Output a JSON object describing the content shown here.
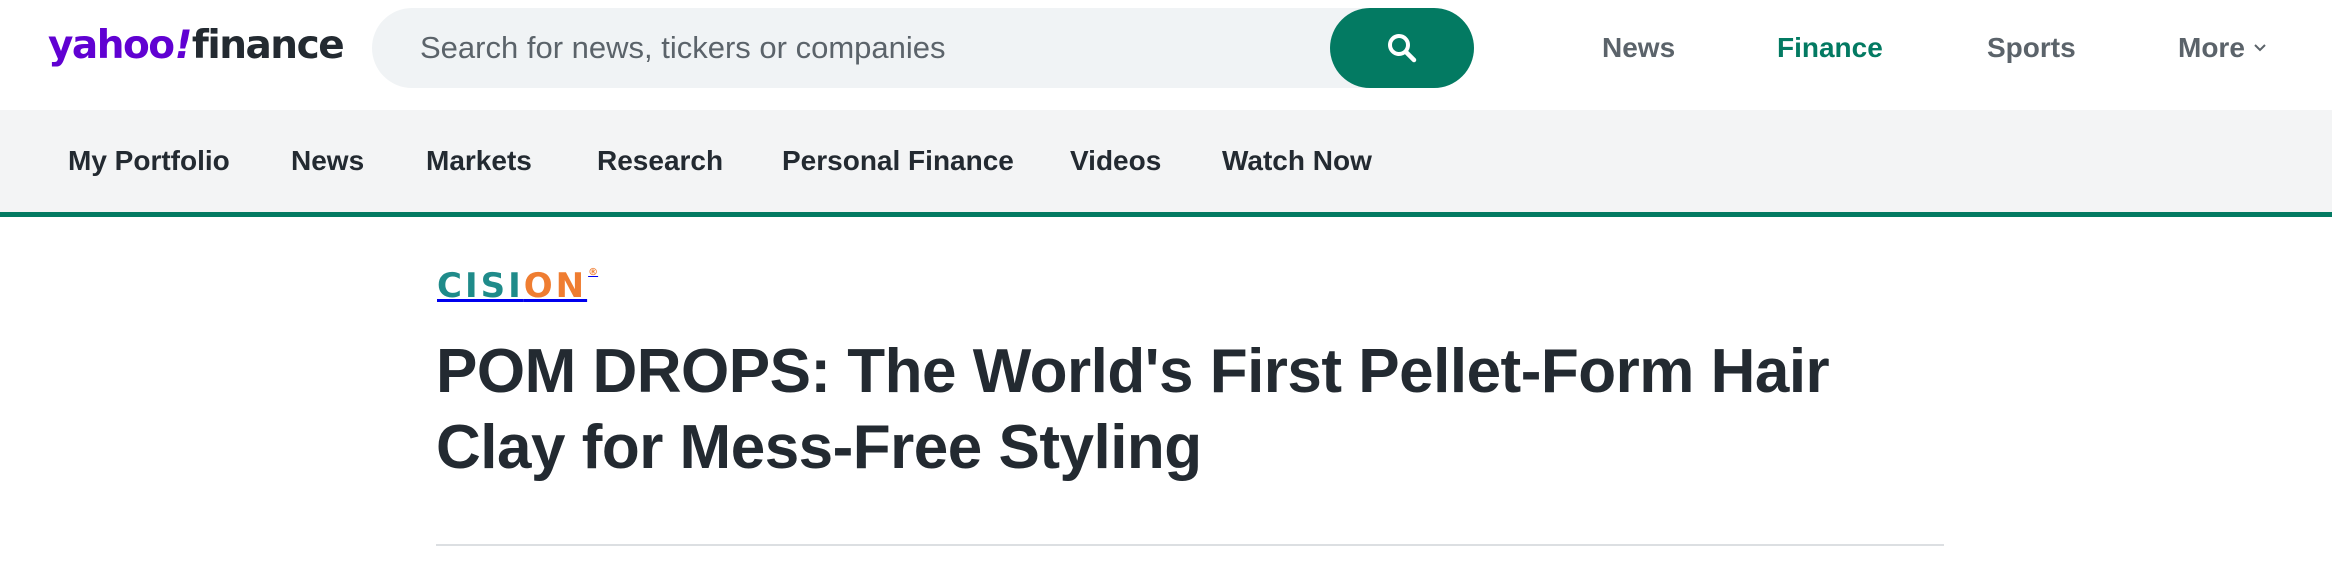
{
  "header": {
    "logo": {
      "yahoo": "yahoo",
      "bang": "!",
      "finance": "finance"
    },
    "search": {
      "placeholder": "Search for news, tickers or companies",
      "button_icon": "search-icon"
    },
    "nav": [
      {
        "label": "News",
        "active": false
      },
      {
        "label": "Finance",
        "active": true
      },
      {
        "label": "Sports",
        "active": false
      },
      {
        "label": "More",
        "active": false
      }
    ]
  },
  "subnav": {
    "items": [
      {
        "label": "My Portfolio"
      },
      {
        "label": "News"
      },
      {
        "label": "Markets"
      },
      {
        "label": "Research"
      },
      {
        "label": "Personal Finance"
      },
      {
        "label": "Videos"
      },
      {
        "label": "Watch Now"
      }
    ]
  },
  "article": {
    "source_logo": {
      "part1": "CISI",
      "part2": "ON",
      "tm": "®"
    },
    "headline": "POM DROPS: The World's First Pellet-Form Hair Clay for Mess-Free Styling"
  },
  "colors": {
    "brand_purple": "#6001d2",
    "accent_green": "#037a62",
    "text_dark": "#232a31",
    "text_muted": "#5b636a",
    "subnav_bg": "#f3f4f5",
    "cision_teal": "#1f8b8a",
    "cision_orange": "#ef7d31"
  }
}
